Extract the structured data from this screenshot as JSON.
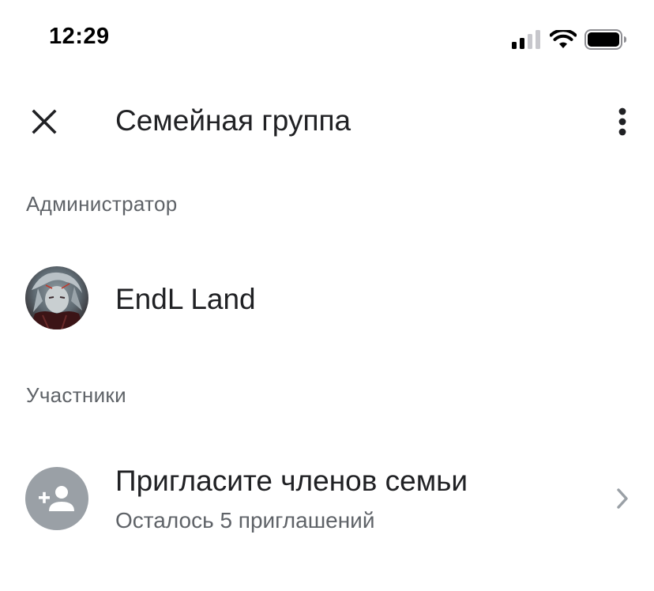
{
  "status_bar": {
    "time": "12:29",
    "icons": [
      "signal-icon",
      "wifi-icon",
      "battery-icon"
    ]
  },
  "app_bar": {
    "title": "Семейная группа",
    "close_icon": "close-icon",
    "more_icon": "more-vert-icon"
  },
  "admin_section": {
    "header": "Администратор",
    "member": {
      "name": "EndL Land"
    }
  },
  "members_section": {
    "header": "Участники",
    "invite": {
      "title": "Пригласите членов семьи",
      "subtitle": "Осталось 5 приглашений",
      "icon": "person-add-icon"
    }
  },
  "colors": {
    "text_primary": "#202124",
    "text_secondary": "#5f6368",
    "icon_gray": "#9aa0a6",
    "chevron": "#9aa0a6"
  }
}
